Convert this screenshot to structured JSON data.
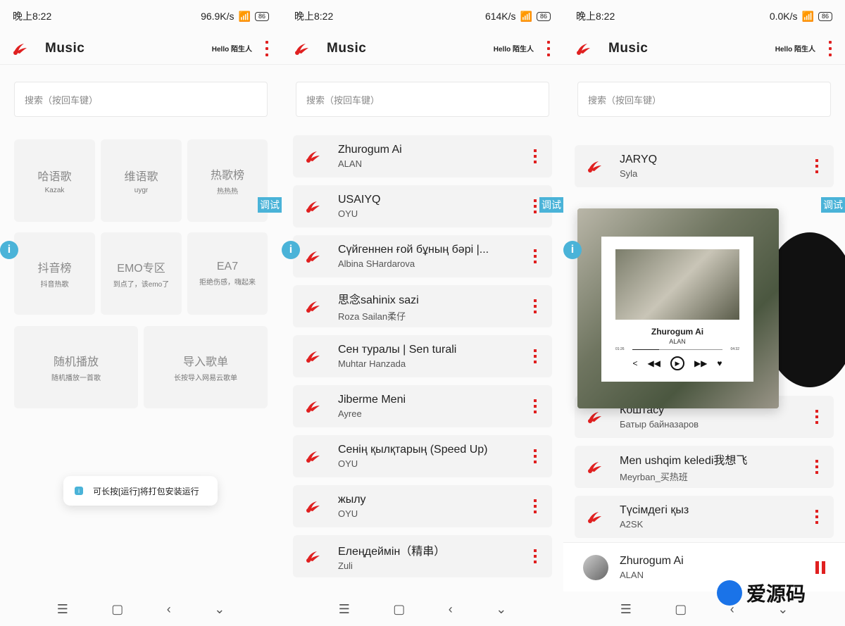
{
  "statusbar": [
    {
      "time": "晚上8:22",
      "speed": "96.9K/s",
      "battery": "86"
    },
    {
      "time": "晚上8:22",
      "speed": "614K/s",
      "battery": "86"
    },
    {
      "time": "晚上8:22",
      "speed": "0.0K/s",
      "battery": "86"
    }
  ],
  "app": {
    "title": "Music",
    "greeting": "Hello 陌生人"
  },
  "search": {
    "placeholder": "搜索（按回车键）"
  },
  "debug_tag": "调试",
  "tiles": [
    {
      "title": "哈语歌",
      "sub": "Kazak"
    },
    {
      "title": "维语歌",
      "sub": "uygr"
    },
    {
      "title": "热歌榜",
      "sub": "热热热"
    },
    {
      "title": "抖音榜",
      "sub": "抖音热歌"
    },
    {
      "title": "EMO专区",
      "sub": "到点了，该emo了"
    },
    {
      "title": "EA7",
      "sub": "拒绝伤感，嗨起来"
    },
    {
      "title": "随机播放",
      "sub": "随机播放一首歌"
    },
    {
      "title": "导入歌单",
      "sub": "长按导入网易云歌单"
    }
  ],
  "toast": "可长按[运行]将打包安装运行",
  "songs": [
    {
      "title": "Zhurogum Ai",
      "artist": "ALAN"
    },
    {
      "title": "USAIYQ",
      "artist": "OYU"
    },
    {
      "title": "Сүйгеннен ғой бұның бәрі |...",
      "artist": "Albina SHardarova"
    },
    {
      "title": "思念sahinix sazi",
      "artist": "Roza Sailan柔仔"
    },
    {
      "title": "Сен туралы | Sen turali",
      "artist": "Muhtar Hanzada"
    },
    {
      "title": "Jiberme Meni",
      "artist": "Ayree"
    },
    {
      "title": "Сенің қылқтарың (Speed Up)",
      "artist": "OYU"
    },
    {
      "title": "жылу",
      "artist": "OYU"
    },
    {
      "title": "Елеңдеймін（精串）",
      "artist": "Zuli"
    }
  ],
  "songs3": [
    {
      "title": "JARYQ",
      "artist": "Syla"
    },
    {
      "title": "Коштасу",
      "artist": "Батыр байназаров"
    },
    {
      "title": "Men ushqim keledi我想飞",
      "artist": "Meyrban_买热班"
    },
    {
      "title": "Түсімдегі қыз",
      "artist": "A2SK"
    }
  ],
  "player_card": {
    "song": "Zhurogum Ai",
    "artist": "ALAN",
    "time_elapsed": "01:26",
    "time_total": "04:32",
    "progress": 0.3
  },
  "mini_player": {
    "title": "Zhurogum Ai",
    "artist": "ALAN"
  },
  "watermark": {
    "text": "爱源码",
    "url": "a2ym.com"
  },
  "colors": {
    "accent": "#e02020",
    "info": "#4ab3d8"
  }
}
